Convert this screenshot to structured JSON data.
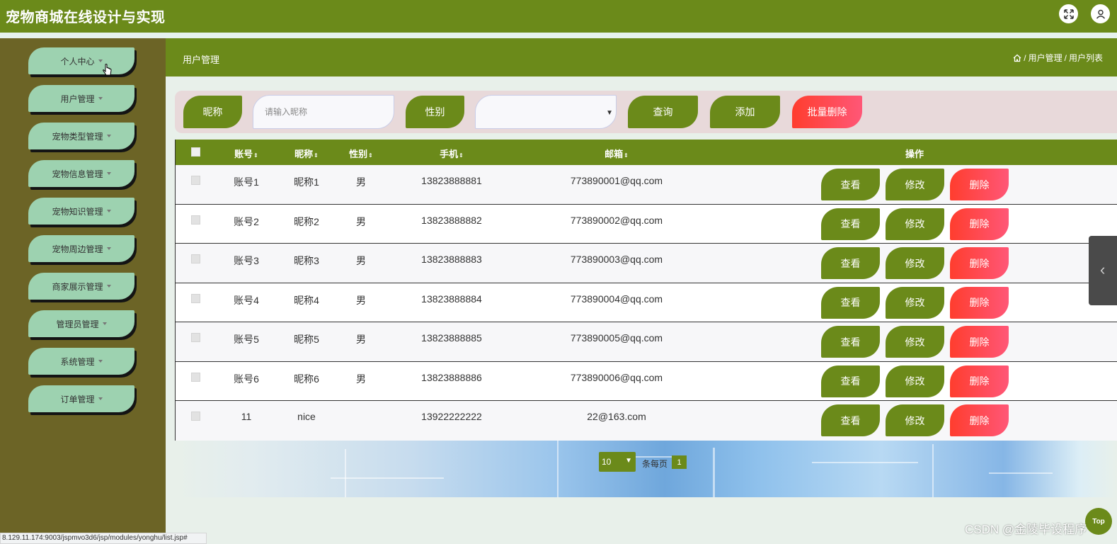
{
  "app": {
    "title": "宠物商城在线设计与实现"
  },
  "topbar": {
    "icons": [
      "fullscreen-icon",
      "user-icon"
    ]
  },
  "sidebar": {
    "items": [
      {
        "label": "个人中心"
      },
      {
        "label": "用户管理"
      },
      {
        "label": "宠物类型管理"
      },
      {
        "label": "宠物信息管理"
      },
      {
        "label": "宠物知识管理"
      },
      {
        "label": "宠物周边管理"
      },
      {
        "label": "商家展示管理"
      },
      {
        "label": "管理员管理"
      },
      {
        "label": "系统管理"
      },
      {
        "label": "订单管理"
      }
    ]
  },
  "header": {
    "title": "用户管理",
    "breadcrumb": [
      "用户管理",
      "用户列表"
    ],
    "separator": "/"
  },
  "search": {
    "nickname_label": "昵称",
    "nickname_placeholder": "请输入昵称",
    "nickname_value": "",
    "gender_label": "性别",
    "gender_value": "",
    "query_button": "查询",
    "add_button": "添加",
    "batch_delete_button": "批量删除"
  },
  "table": {
    "columns": [
      "账号",
      "昵称",
      "性别",
      "手机",
      "邮箱",
      "操作"
    ],
    "sort_glyph": "⇕",
    "rows": [
      {
        "account": "账号1",
        "nickname": "昵称1",
        "gender": "男",
        "phone": "13823888881",
        "email": "773890001@qq.com"
      },
      {
        "account": "账号2",
        "nickname": "昵称2",
        "gender": "男",
        "phone": "13823888882",
        "email": "773890002@qq.com"
      },
      {
        "account": "账号3",
        "nickname": "昵称3",
        "gender": "男",
        "phone": "13823888883",
        "email": "773890003@qq.com"
      },
      {
        "account": "账号4",
        "nickname": "昵称4",
        "gender": "男",
        "phone": "13823888884",
        "email": "773890004@qq.com"
      },
      {
        "account": "账号5",
        "nickname": "昵称5",
        "gender": "男",
        "phone": "13823888885",
        "email": "773890005@qq.com"
      },
      {
        "account": "账号6",
        "nickname": "昵称6",
        "gender": "男",
        "phone": "13823888886",
        "email": "773890006@qq.com"
      },
      {
        "account": "11",
        "nickname": "nice",
        "gender": "",
        "phone": "13922222222",
        "email": "22@163.com"
      }
    ],
    "actions": {
      "view": "查看",
      "edit": "修改",
      "delete": "删除"
    }
  },
  "pager": {
    "page_size": "10",
    "page_size_label": "条每页",
    "current_page": "1"
  },
  "top_button": "Top",
  "watermark": "CSDN @金陵毕设程序",
  "status_url": "8.129.11.174:9003/jspmvo3d6/jsp/modules/yonghu/list.jsp#",
  "colors": {
    "primary": "#6b8a1a",
    "sidebar": "#6c6426",
    "menu_item": "#9dd2b0",
    "danger_start": "#ff3d2e",
    "danger_end": "#ff5777",
    "search_panel": "#e8d9da"
  }
}
